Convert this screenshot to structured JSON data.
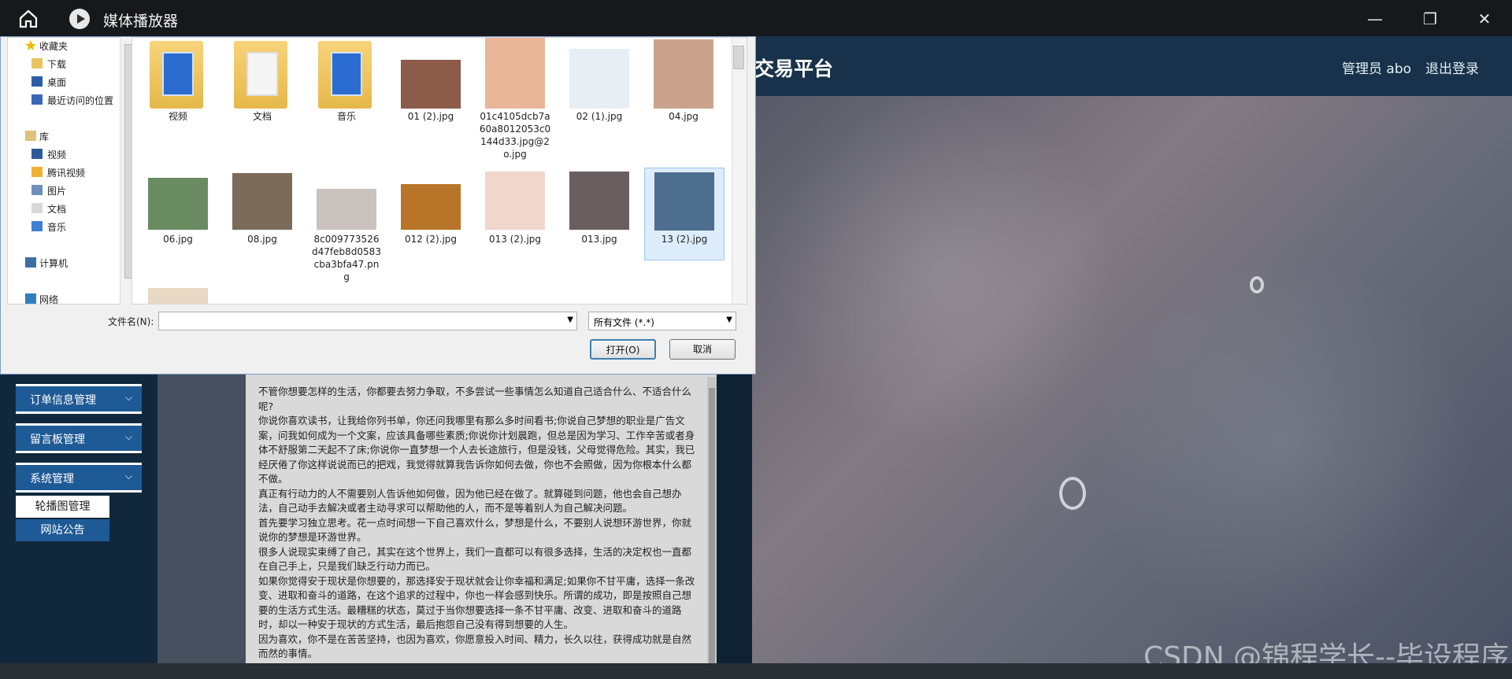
{
  "window": {
    "app_title": "媒体播放器",
    "home_icon": "home-icon",
    "player_icon": "play-icon"
  },
  "app": {
    "brand": "交易平台",
    "admin_label": "管理员 abo",
    "logout": "退出登录",
    "sidebar": {
      "menus": [
        "订单信息管理",
        "留言板管理",
        "系统管理"
      ],
      "submenus": [
        "轮播图管理",
        "网站公告"
      ]
    },
    "content_text": [
      "不管你想要怎样的生活，你都要去努力争取，不多尝试一些事情怎么知道自己适合什么、不适合什么呢?",
      "你说你喜欢读书，让我给你列书单，你还问我哪里有那么多时间看书;你说自己梦想的职业是广告文案，问我如何成为一个文案，应该具备哪些素质;你说你计划晨跑，但总是因为学习、工作辛苦或者身体不舒服第二天起不了床;你说你一直梦想一个人去长途旅行，但是没钱，父母觉得危险。其实，我已经厌倦了你这样说说而已的把戏，我觉得就算我告诉你如何去做，你也不会照做，因为你根本什么都不做。",
      "真正有行动力的人不需要别人告诉他如何做，因为他已经在做了。就算碰到问题，他也会自己想办法，自己动手去解决或者主动寻求可以帮助他的人，而不是等着别人为自己解决问题。",
      "首先要学习独立思考。花一点时间想一下自己喜欢什么，梦想是什么，不要别人说想环游世界，你就说你的梦想是环游世界。",
      "很多人说现实束缚了自己，其实在这个世界上，我们一直都可以有很多选择，生活的决定权也一直都在自己手上，只是我们缺乏行动力而已。",
      "如果你觉得安于现状是你想要的，那选择安于现状就会让你幸福和满足;如果你不甘平庸，选择一条改变、进取和奋斗的道路，在这个追求的过程中，你也一样会感到快乐。所谓的成功，即是按照自己想要的生活方式生活。最糟糕的状态，莫过于当你想要选择一条不甘平庸、改变、进取和奋斗的道路时，却以一种安于现状的方式生活，最后抱怨自己没有得到想要的人生。",
      "因为喜欢，你不是在苦苦坚持，也因为喜欢，你愿意投入时间、精力，长久以往，获得成功就是自然而然的事情。"
    ],
    "watermark": "CSDN @锦程学长--毕设程序"
  },
  "dialog": {
    "tree": [
      {
        "label": "收藏夹",
        "icon": "star-icon",
        "section": true
      },
      {
        "label": "下载",
        "icon": "download-folder-icon"
      },
      {
        "label": "桌面",
        "icon": "desktop-icon"
      },
      {
        "label": "最近访问的位置",
        "icon": "recent-places-icon"
      },
      {
        "label": "库",
        "icon": "library-icon",
        "section": true
      },
      {
        "label": "视频",
        "icon": "video-library-icon"
      },
      {
        "label": "腾讯视频",
        "icon": "folder-icon"
      },
      {
        "label": "图片",
        "icon": "pictures-library-icon"
      },
      {
        "label": "文档",
        "icon": "documents-library-icon"
      },
      {
        "label": "音乐",
        "icon": "music-library-icon"
      },
      {
        "label": "计算机",
        "icon": "computer-icon",
        "section": true
      },
      {
        "label": "网络",
        "icon": "network-icon",
        "section": true
      }
    ],
    "files_row1": [
      {
        "name": "视频",
        "kind": "folder-blue"
      },
      {
        "name": "文档",
        "kind": "folder-light"
      },
      {
        "name": "音乐",
        "kind": "folder-blue"
      },
      {
        "name": "01 (2).jpg",
        "kind": "photo",
        "color": "#8c5b4a"
      },
      {
        "name": "01c4105dcb7a60a8012053c0144d33.jpg@2o.jpg",
        "kind": "photo",
        "color": "#e9b69a"
      },
      {
        "name": "02 (1).jpg",
        "kind": "photo",
        "color": "#e8eef4"
      },
      {
        "name": "04.jpg",
        "kind": "photo",
        "color": "#c9a38c"
      }
    ],
    "files_row2": [
      {
        "name": "06.jpg",
        "kind": "photo",
        "color": "#6a8b62"
      },
      {
        "name": "08.jpg",
        "kind": "photo",
        "color": "#7a6b5a"
      },
      {
        "name": "8c009773526d47feb8d0583cba3bfa47.png",
        "kind": "photo",
        "color": "#c9c2bf"
      },
      {
        "name": "012 (2).jpg",
        "kind": "photo",
        "color": "#b8752a"
      },
      {
        "name": "013 (2).jpg",
        "kind": "photo",
        "color": "#f1d6cc"
      },
      {
        "name": "013.jpg",
        "kind": "photo",
        "color": "#6a5f60"
      },
      {
        "name": "13 (2).jpg",
        "kind": "photo",
        "color": "#4e6e8f",
        "selected": true
      }
    ],
    "filename_label": "文件名(N):",
    "filename_value": "",
    "filetype_value": "所有文件 (*.*)",
    "open_button": "打开(O)",
    "cancel_button": "取消",
    "dropdown_icon": "chevron-down-icon"
  }
}
